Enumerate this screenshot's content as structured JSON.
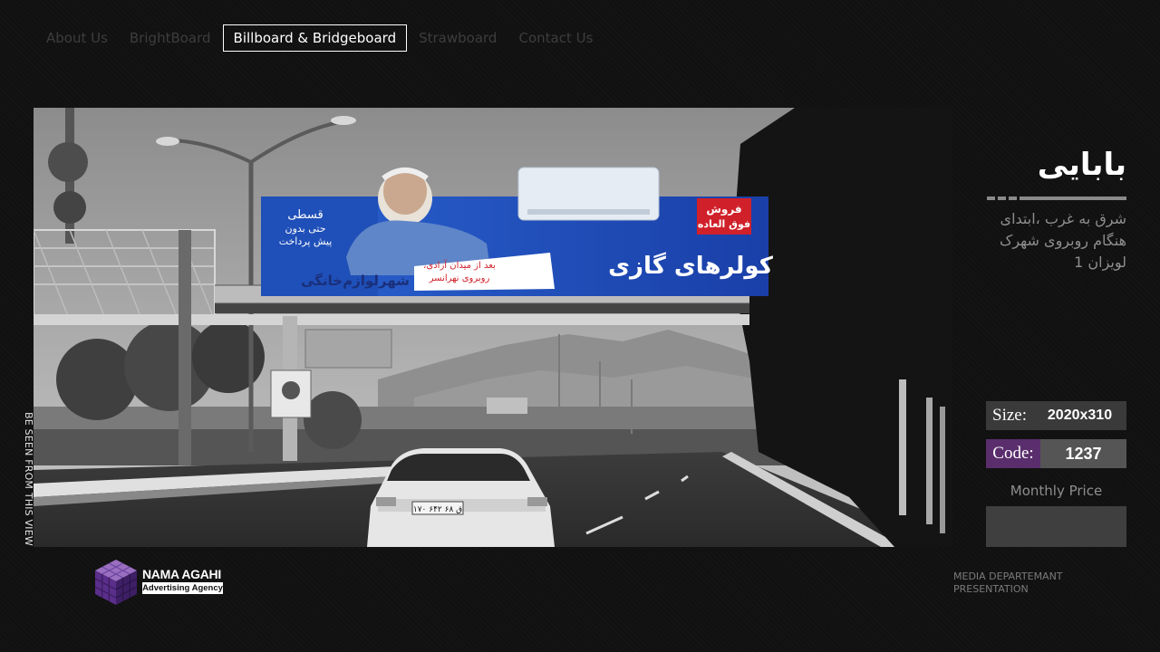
{
  "nav": {
    "items": [
      {
        "label": "About Us",
        "active": false
      },
      {
        "label": "BrightBoard",
        "active": false
      },
      {
        "label": "Billboard & Bridgeboard",
        "active": true
      },
      {
        "label": "Strawboard",
        "active": false
      },
      {
        "label": "Contact Us",
        "active": false
      }
    ]
  },
  "photo": {
    "side_caption": "BE SEEN FROM THIS VIEW",
    "billboard": {
      "sale_line1": "فروش",
      "sale_line2": "فوق العاده",
      "headline": "کولرهای گازی",
      "installment_line1": "قسطی",
      "installment_line2": "حتی بدون",
      "installment_line3": "پیش پرداخت",
      "address_line1": "بعد از میدان آزادی،",
      "address_line2": "روبروی نهرانسر",
      "store_name": "شهرلوازم‌خانگی"
    },
    "plate": "۱۷۰ ۶۴۲ ق ۶۸"
  },
  "location": {
    "title": "بابایی",
    "description": "شرق به غرب ،ابتدای هنگام روبروی شهرک لویزان 1"
  },
  "specs": {
    "size_label": "Size:",
    "size_value": "2020x310",
    "code_label": "Code:",
    "code_value": "1237",
    "monthly_label": "Monthly Price",
    "monthly_value": ""
  },
  "branding": {
    "logo_name": "NAMA AGAHI",
    "logo_tagline": "Advertising Agency",
    "footnote_line1": "MEDIA DEPARTEMANT",
    "footnote_line2": "PRESENTATION"
  },
  "colors": {
    "accent_purple": "#5a2e6c",
    "billboard_blue": "#1f4fb8",
    "sale_red": "#d0202a"
  },
  "icons": [
    "cube-logo-icon"
  ]
}
